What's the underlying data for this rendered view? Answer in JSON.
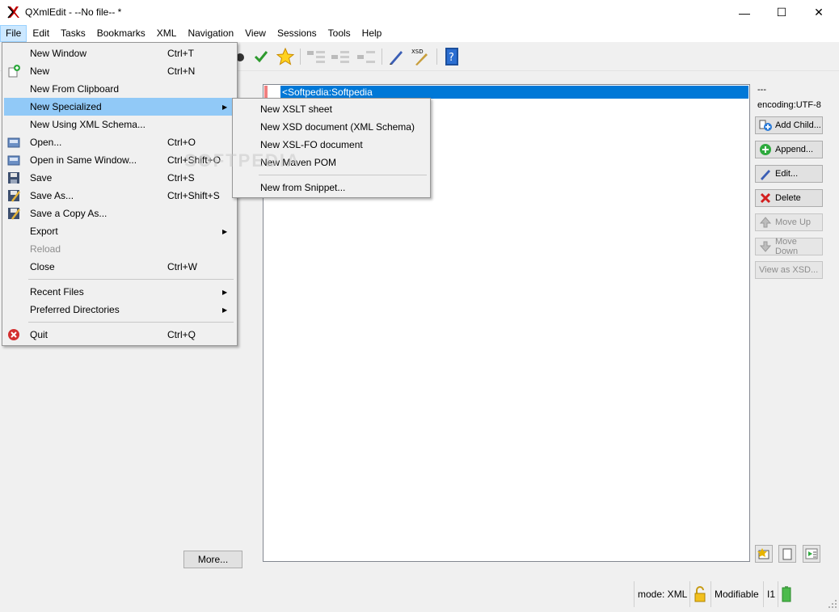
{
  "window": {
    "title": "QXmlEdit - --No file-- *",
    "minimize_glyph": "—",
    "maximize_glyph": "☐",
    "close_glyph": "✕"
  },
  "menubar": {
    "items": [
      "File",
      "Edit",
      "Tasks",
      "Bookmarks",
      "XML",
      "Navigation",
      "View",
      "Sessions",
      "Tools",
      "Help"
    ]
  },
  "file_menu": {
    "items": [
      {
        "label": "New Window",
        "shortcut": "Ctrl+T"
      },
      {
        "label": "New",
        "shortcut": "Ctrl+N",
        "icon": "new-file-icon"
      },
      {
        "label": "New From Clipboard",
        "shortcut": ""
      },
      {
        "label": "New Specialized",
        "shortcut": "",
        "submenu": true
      },
      {
        "label": "New Using XML Schema...",
        "shortcut": ""
      },
      {
        "label": "Open...",
        "shortcut": "Ctrl+O",
        "icon": "open-icon"
      },
      {
        "label": "Open in Same Window...",
        "shortcut": "Ctrl+Shift+O",
        "icon": "open-icon"
      },
      {
        "label": "Save",
        "shortcut": "Ctrl+S",
        "icon": "save-icon"
      },
      {
        "label": "Save As...",
        "shortcut": "Ctrl+Shift+S",
        "icon": "save-as-icon"
      },
      {
        "label": "Save a Copy As...",
        "shortcut": "",
        "icon": "save-as-icon"
      },
      {
        "label": "Export",
        "shortcut": "",
        "submenu": true
      },
      {
        "label": "Reload",
        "shortcut": "",
        "disabled": true
      },
      {
        "label": "Close",
        "shortcut": "Ctrl+W"
      },
      {
        "label": "Recent Files",
        "shortcut": "",
        "submenu": true
      },
      {
        "label": "Preferred Directories",
        "shortcut": "",
        "submenu": true
      },
      {
        "label": "Quit",
        "shortcut": "Ctrl+Q",
        "icon": "quit-icon"
      }
    ]
  },
  "specialized_submenu": {
    "items": [
      "New XSLT sheet",
      "New XSD document (XML Schema)",
      "New XSL-FO document",
      "New Maven POM",
      "New from Snippet..."
    ]
  },
  "tree": {
    "selected_row": "<Softpedia:Softpedia"
  },
  "right_panel": {
    "dashes": "---",
    "encoding": "encoding:UTF-8",
    "buttons": [
      {
        "label": "Add Child...",
        "icon": "add-child-icon",
        "enabled": true
      },
      {
        "label": "Append...",
        "icon": "append-icon",
        "enabled": true
      },
      {
        "label": "Edit...",
        "icon": "edit-icon",
        "enabled": true
      },
      {
        "label": "Delete",
        "icon": "delete-icon",
        "enabled": true
      },
      {
        "label": "Move Up",
        "icon": "move-up-icon",
        "enabled": false
      },
      {
        "label": "Move Down",
        "icon": "move-down-icon",
        "enabled": false
      },
      {
        "label": "View as XSD...",
        "icon": "",
        "enabled": false
      }
    ]
  },
  "left_panel": {
    "more_button": "More..."
  },
  "statusbar": {
    "mode": "mode: XML",
    "modifiable": "Modifiable",
    "indent": "I1"
  },
  "watermark": "SOFTPEDIA",
  "colors": {
    "selection": "#0078d7",
    "menu_highlight": "#91c9f7",
    "menubar_active": "#cce8ff"
  }
}
